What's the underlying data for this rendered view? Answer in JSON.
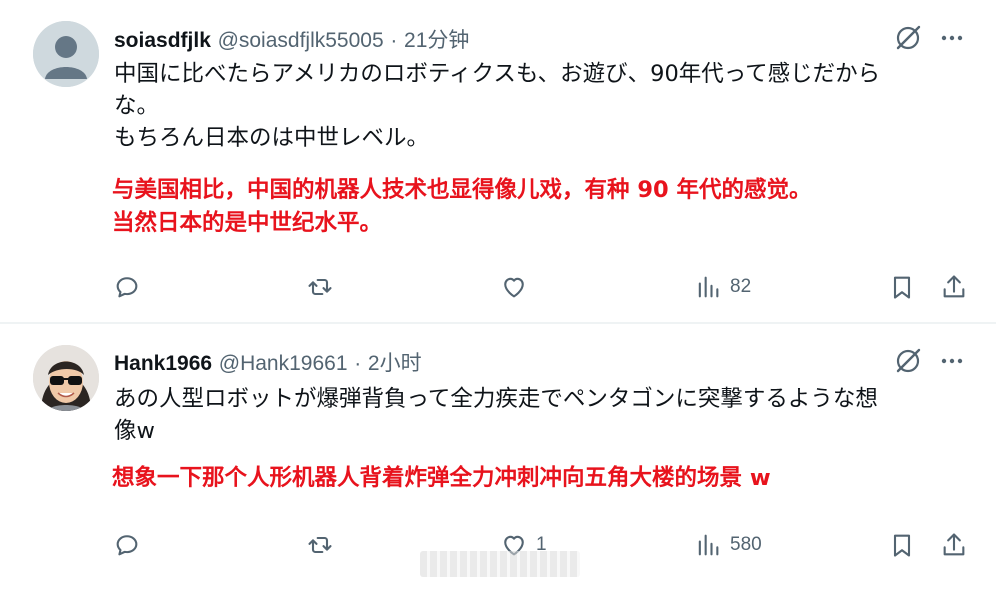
{
  "tweets": [
    {
      "name": "soiasdfjlk",
      "handle": "@soiasdfjlk55005",
      "separator": "·",
      "time": "21分钟",
      "text_lines": [
        "中国に比べたらアメリカのロボティクスも、お遊び、90年代って感じだから",
        "な。",
        "もちろん日本のは中世レベル。"
      ],
      "translation_lines": [
        "与美国相比，中国的机器人技术也显得像儿戏，有种 90 年代的感觉。",
        "当然日本的是中世纪水平。"
      ],
      "actions": {
        "reply": "",
        "retweet": "",
        "like": "",
        "views": "82"
      }
    },
    {
      "name": "Hank1966",
      "handle": "@Hank19661",
      "separator": "·",
      "time": "2小时",
      "text_lines": [
        "あの人型ロボットが爆弾背負って全力疾走でペンタゴンに突撃するような想",
        "像w"
      ],
      "translation_lines": [
        "想象一下那个人形机器人背着炸弹全力冲刺冲向五角大楼的场景 w"
      ],
      "actions": {
        "reply": "",
        "retweet": "",
        "like": "1",
        "views": "580"
      }
    }
  ],
  "icons": {
    "reply": "reply-icon",
    "retweet": "retweet-icon",
    "like": "heart-icon",
    "views": "views-icon",
    "bookmark": "bookmark-icon",
    "share": "share-icon",
    "grok": "grok-icon",
    "more": "more-icon"
  },
  "colors": {
    "text": "#0f1419",
    "secondary": "#536471",
    "translation": "#e8131d",
    "divider": "#eff3f4"
  }
}
